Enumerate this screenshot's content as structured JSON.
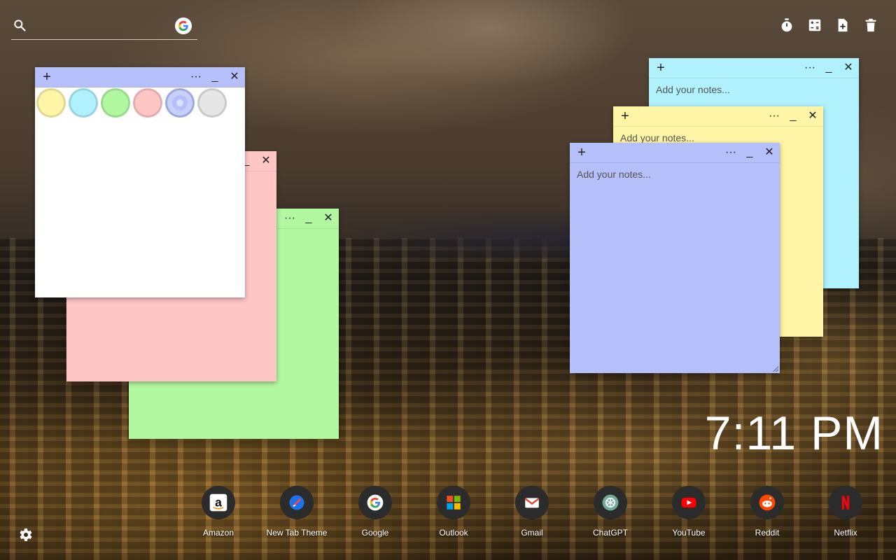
{
  "search": {
    "placeholder": "",
    "value": ""
  },
  "toolbar": {
    "icons": [
      "timer-icon",
      "calculator-icon",
      "new-note-icon",
      "trash-icon"
    ]
  },
  "notes": {
    "placeholder": "Add your notes...",
    "add_glyph": "+",
    "menu_glyph": "···",
    "minimize_glyph": "_",
    "close_glyph": "✕",
    "colors": {
      "white": "#ffffff",
      "pink": "#ffc6c6",
      "green": "#b1f8a0",
      "cyan": "#b0f1fd",
      "yellow": "#fff5a6",
      "blue": "#b5c0fa"
    }
  },
  "swatches": [
    {
      "name": "yellow",
      "color": "#fff5a6"
    },
    {
      "name": "cyan",
      "color": "#b0f1fd"
    },
    {
      "name": "green",
      "color": "#b1f8a0"
    },
    {
      "name": "pink",
      "color": "#ffc6c6"
    },
    {
      "name": "blue",
      "color": "#b5c0fa",
      "selected": true
    },
    {
      "name": "gray",
      "color": "#e6e6e6"
    }
  ],
  "clock": {
    "time": "7:11 PM"
  },
  "dock": [
    {
      "label": "Amazon",
      "icon": "amazon-icon"
    },
    {
      "label": "New Tab Theme",
      "icon": "new-tab-theme-icon"
    },
    {
      "label": "Google",
      "icon": "google-icon"
    },
    {
      "label": "Outlook",
      "icon": "outlook-icon"
    },
    {
      "label": "Gmail",
      "icon": "gmail-icon"
    },
    {
      "label": "ChatGPT",
      "icon": "chatgpt-icon"
    },
    {
      "label": "YouTube",
      "icon": "youtube-icon"
    },
    {
      "label": "Reddit",
      "icon": "reddit-icon"
    },
    {
      "label": "Netflix",
      "icon": "netflix-icon"
    }
  ]
}
